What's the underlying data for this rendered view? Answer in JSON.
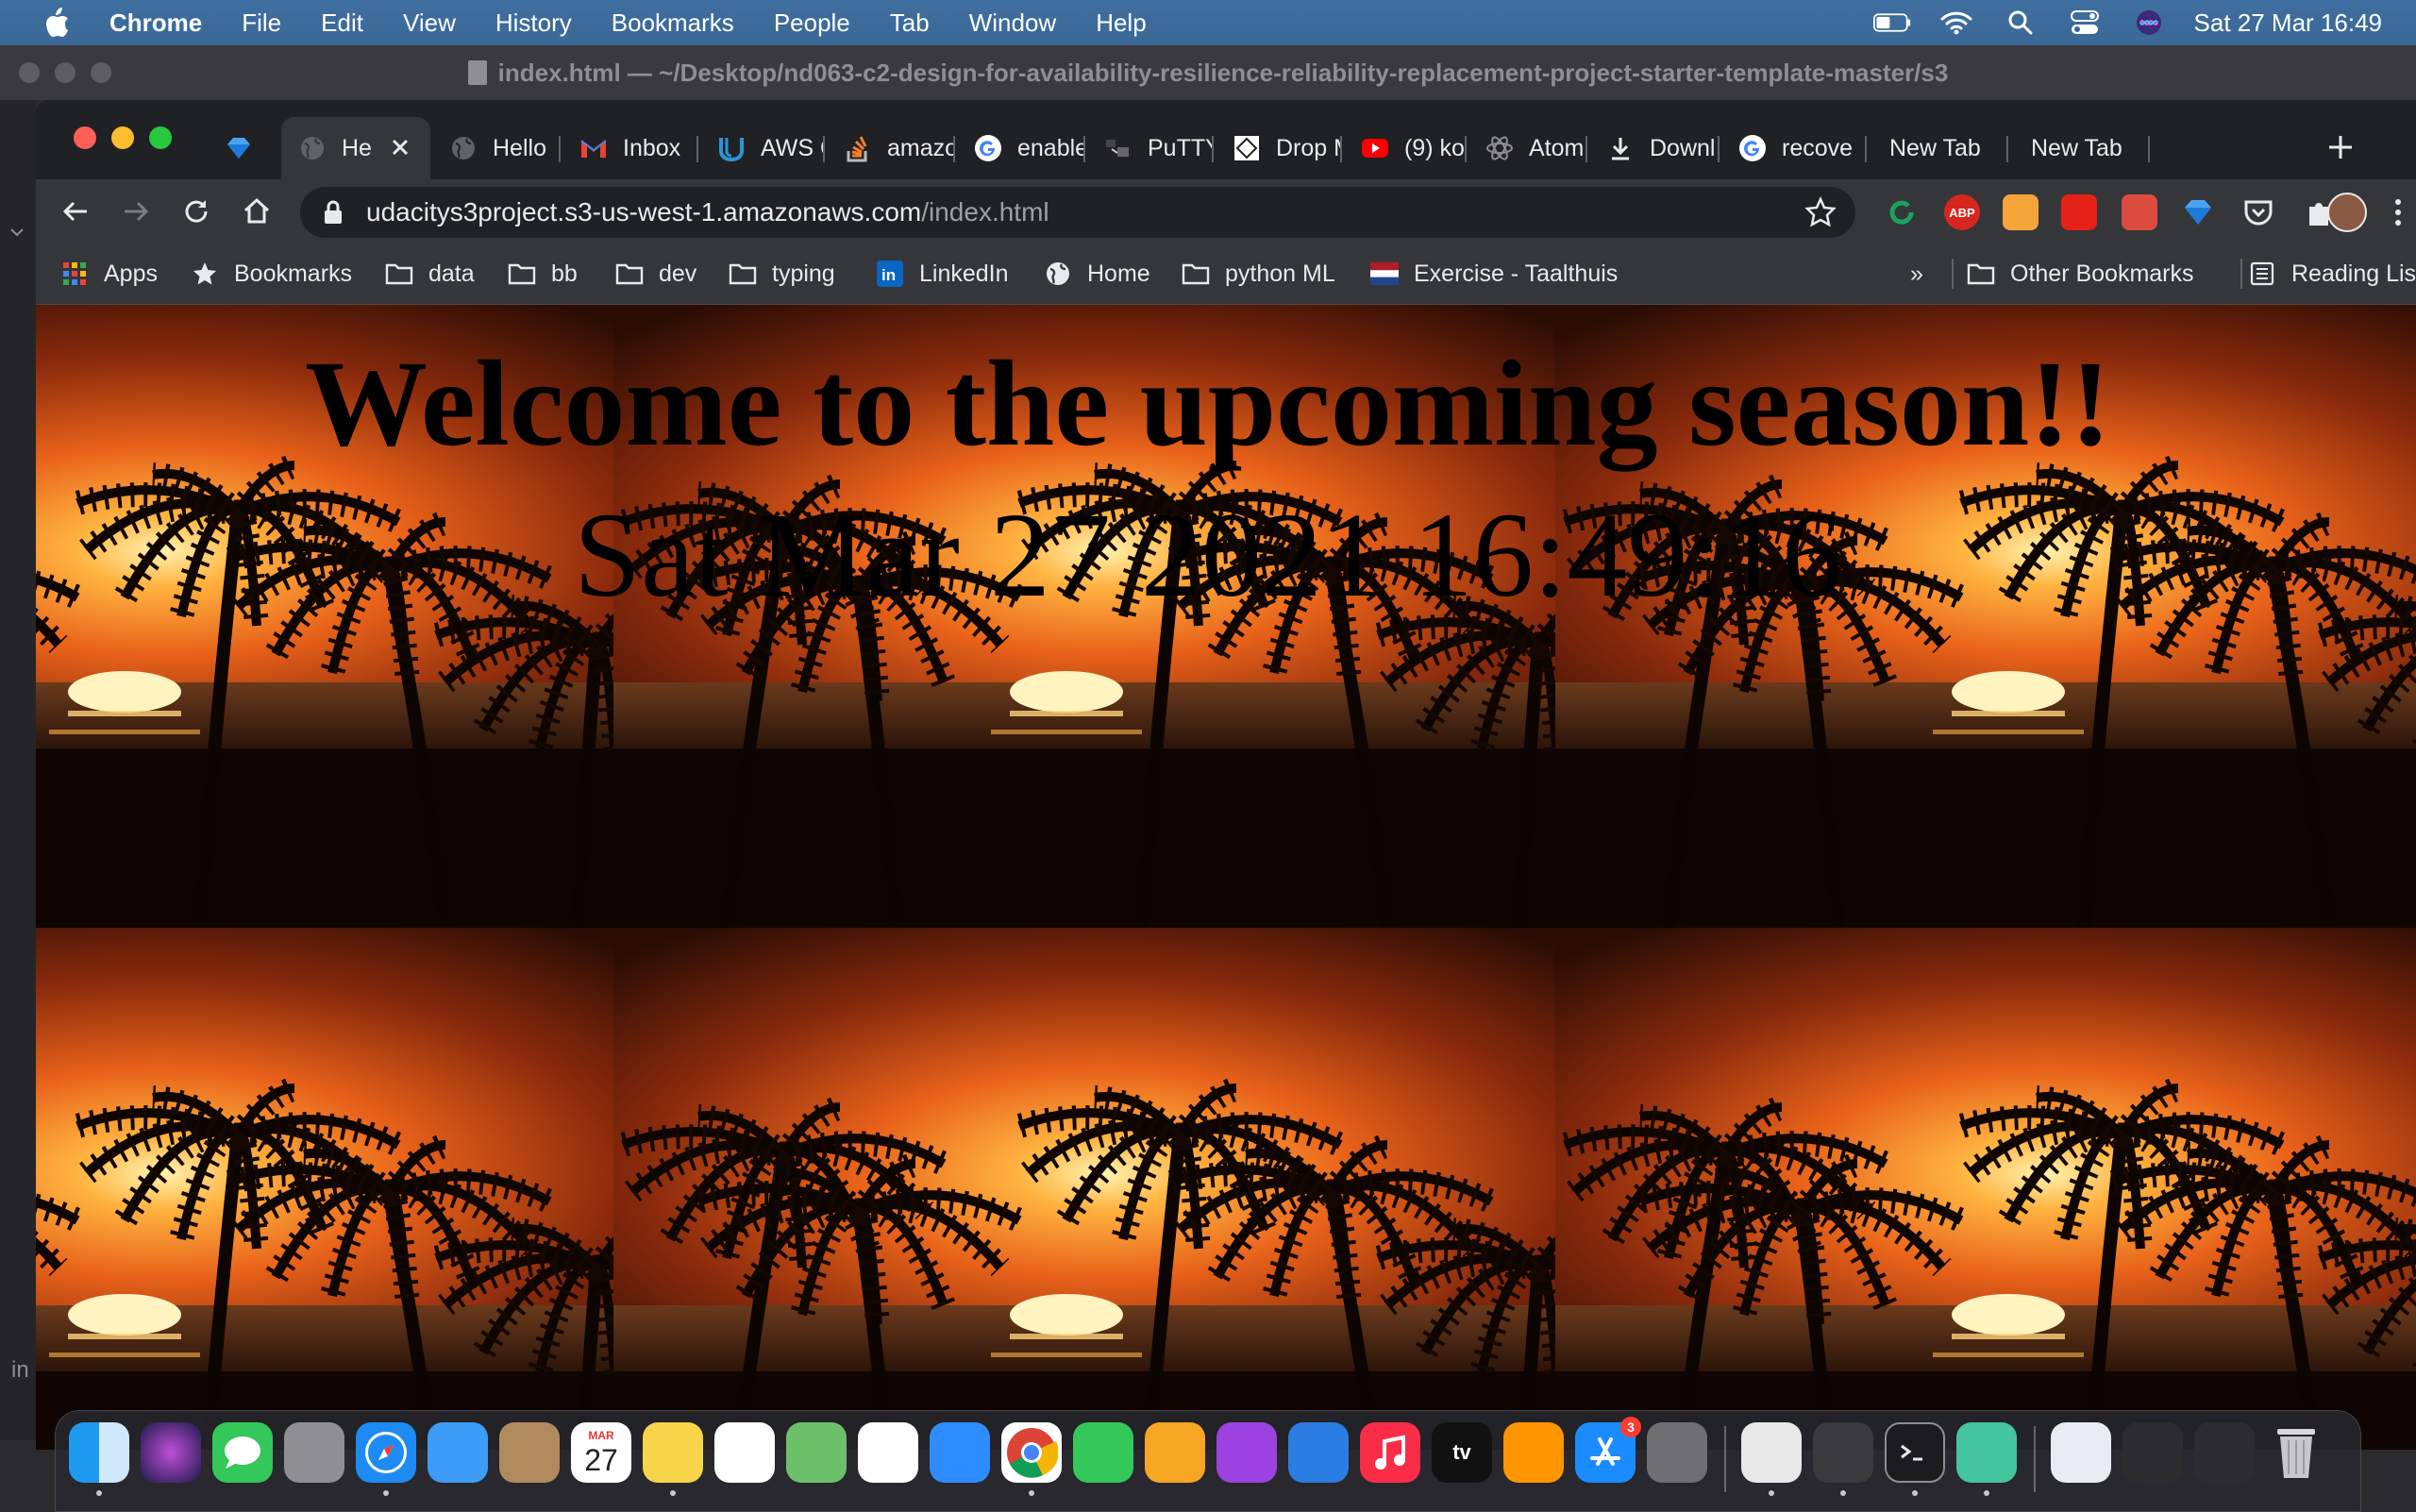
{
  "menubar": {
    "app_name": "Chrome",
    "items": [
      "File",
      "Edit",
      "View",
      "History",
      "Bookmarks",
      "People",
      "Tab",
      "Window",
      "Help"
    ],
    "clock": "Sat 27 Mar  16:49"
  },
  "background_window": {
    "title": "index.html — ~/Desktop/nd063-c2-design-for-availability-resilience-reliability-replacement-project-starter-template-master/s3",
    "footer_text": "in"
  },
  "tabs": [
    {
      "label": "He",
      "icon": "globe-icon",
      "active": true
    },
    {
      "label": "Hello",
      "icon": "globe-icon"
    },
    {
      "label": "Inbox",
      "icon": "gmail-icon"
    },
    {
      "label": "AWS C",
      "icon": "udacity-icon"
    },
    {
      "label": "amazo",
      "icon": "stackoverflow-icon"
    },
    {
      "label": "enable",
      "icon": "google-icon"
    },
    {
      "label": "PuTTY",
      "icon": "putty-icon"
    },
    {
      "label": "Drop M",
      "icon": "dropbox-icon"
    },
    {
      "label": "(9) ko",
      "icon": "youtube-icon"
    },
    {
      "label": "Atom",
      "icon": "atom-icon"
    },
    {
      "label": "Downl",
      "icon": "download-icon"
    },
    {
      "label": "recove",
      "icon": "google-icon"
    },
    {
      "label": "New Tab",
      "icon": ""
    },
    {
      "label": "New Tab",
      "icon": ""
    }
  ],
  "address_bar": {
    "host": "udacitys3project.s3-us-west-1.amazonaws.com",
    "path": "/index.html"
  },
  "extensions": [
    {
      "name": "grammarly-icon",
      "label": "",
      "color": "#1aa260"
    },
    {
      "name": "adblock-plus-icon",
      "label": "ABP",
      "color": "#d7261e"
    },
    {
      "name": "extension-orange-icon",
      "label": "",
      "color": "#f4a53a"
    },
    {
      "name": "youtube-ext-icon",
      "label": "",
      "color": "#e62117"
    },
    {
      "name": "todoist-icon",
      "label": "",
      "color": "#db4c3f"
    },
    {
      "name": "sketch-icon",
      "label": "",
      "color": "#2b7bd6"
    },
    {
      "name": "pocket-icon",
      "label": "",
      "color": "#5f6368"
    },
    {
      "name": "puzzle-icon",
      "label": "",
      "color": "#5f6368"
    }
  ],
  "bookmarks": [
    {
      "label": "Apps",
      "icon": "apps-grid-icon"
    },
    {
      "label": "Bookmarks",
      "icon": "star-icon"
    },
    {
      "label": "data",
      "icon": "folder-icon"
    },
    {
      "label": "bb",
      "icon": "folder-icon"
    },
    {
      "label": "dev",
      "icon": "folder-icon"
    },
    {
      "label": "typing",
      "icon": "folder-icon"
    },
    {
      "label": "LinkedIn",
      "icon": "linkedin-icon"
    },
    {
      "label": "Home",
      "icon": "globe-icon"
    },
    {
      "label": "python ML",
      "icon": "folder-icon"
    },
    {
      "label": "Exercise - Taalthuis",
      "icon": "flag-icon"
    }
  ],
  "bookmarks_overflow": "»",
  "other_bookmarks": "Other Bookmarks",
  "reading_list": "Reading List",
  "page": {
    "heading": "Welcome to the upcoming season!!",
    "date": "Sat Mar 27 2021 16:49:16"
  },
  "dock": {
    "calendar_month": "MAR",
    "calendar_day": "27",
    "appstore_badge": "3",
    "tv_label": "tv",
    "apps": [
      "finder-icon",
      "siri-icon",
      "messages-icon",
      "launchpad-icon",
      "safari-icon",
      "mail-icon",
      "contacts-icon",
      "calendar-icon",
      "notes-icon",
      "reminders-icon",
      "maps-icon",
      "photos-icon",
      "zoom-icon",
      "chrome-icon",
      "facetime-icon",
      "pages-icon",
      "podcasts-icon",
      "keynote-icon",
      "music-icon",
      "appletv-icon",
      "books-icon",
      "appstore-icon",
      "system-preferences-icon",
      "textedit-icon",
      "instruments-icon",
      "terminal-icon",
      "atom-icon",
      "preview-icon",
      "screenshot-icon",
      "activity-icon",
      "trash-icon"
    ]
  }
}
